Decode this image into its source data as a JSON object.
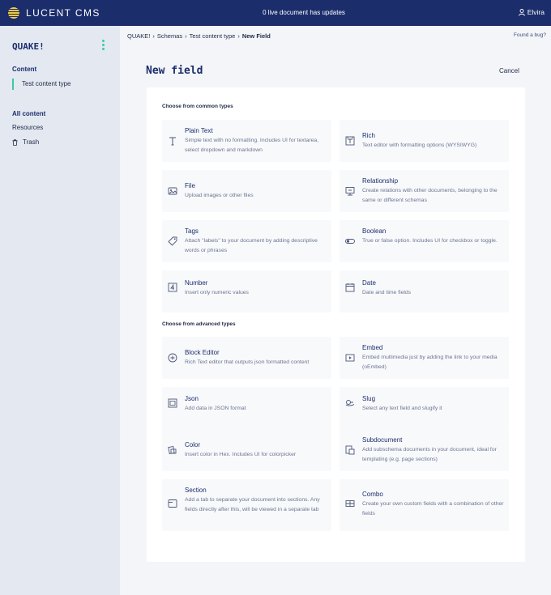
{
  "topbar": {
    "brand": "LUCENT CMS",
    "updates": "0 live document has updates",
    "user": "Elvira"
  },
  "sidebar": {
    "project": "QUAKE!",
    "content_heading": "Content",
    "content_item": "Test content type",
    "all_content": "All content",
    "resources": "Resources",
    "trash": "Trash"
  },
  "breadcrumb": {
    "root": "QUAKE!",
    "schemas": "Schemas",
    "type": "Test content type",
    "current": "New Field",
    "sep": "›"
  },
  "found_bug": "Found a bug?",
  "page_title": "New field",
  "cancel_label": "Cancel",
  "common": {
    "heading": "Choose from common types",
    "items": [
      {
        "name": "Plain Text",
        "desc": "Simple text with no formatting. Includes UI for textarea, select dropdown and markdown",
        "icon": "text-icon"
      },
      {
        "name": "Rich",
        "desc": "Text editor with formatting options (WYSIWYG)",
        "icon": "rich-text-icon"
      },
      {
        "name": "File",
        "desc": "Upload images or other files",
        "icon": "image-icon"
      },
      {
        "name": "Relationship",
        "desc": "Create relations with other documents, belonging to the same or different schemas",
        "icon": "relationship-icon"
      },
      {
        "name": "Tags",
        "desc": "Attach \"labels\" to your document by adding descriptive words or phrases",
        "icon": "tag-icon"
      },
      {
        "name": "Boolean",
        "desc": "True or false option. Includes UI for checkbox or toggle.",
        "icon": "toggle-icon"
      },
      {
        "name": "Number",
        "desc": "Insert only numeric values",
        "icon": "number-icon"
      },
      {
        "name": "Date",
        "desc": "Date and time fields",
        "icon": "calendar-icon"
      }
    ]
  },
  "advanced": {
    "heading": "Choose from advanced types",
    "items": [
      {
        "name": "Block Editor",
        "desc": "Rich Text editor that outputs json formatted content",
        "icon": "plus-circle-icon"
      },
      {
        "name": "Embed",
        "desc": "Embed multimedia just by adding the link to your media (oEmbed)",
        "icon": "play-icon"
      },
      {
        "name": "Json",
        "desc": "Add data in JSON format",
        "icon": "json-icon"
      },
      {
        "name": "Slug",
        "desc": "Select any text field and slugify it",
        "icon": "slug-icon"
      },
      {
        "name": "Color",
        "desc": "Insert color in Hex. Includes UI for colorpicker",
        "icon": "color-icon"
      },
      {
        "name": "Subdocument",
        "desc": "Add subschema documents in your document, ideal for templating (e.g. page sections)",
        "icon": "subdocument-icon"
      },
      {
        "name": "Section",
        "desc": "Add a tab to separate your document into sections. Any fields directly after this, will be viewed in a separate tab",
        "icon": "section-icon"
      },
      {
        "name": "Combo",
        "desc": "Create your own custom fields with a combination of other fields",
        "icon": "combo-icon"
      }
    ]
  }
}
